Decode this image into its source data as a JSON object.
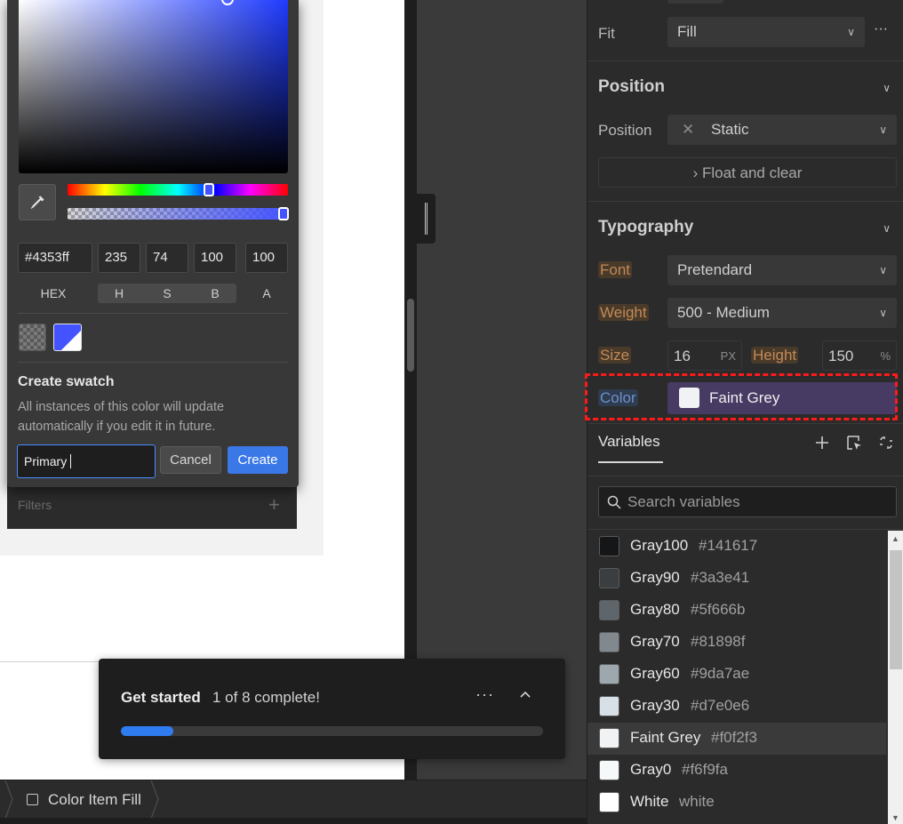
{
  "color_picker": {
    "hex": "#4353ff",
    "h": "235",
    "s": "74",
    "b": "100",
    "a": "100",
    "labels": {
      "hex": "HEX",
      "h": "H",
      "s": "S",
      "b": "B",
      "a": "A"
    },
    "swatch_title": "Create swatch",
    "swatch_description": "All instances of this color will update automatically if you edit it in future.",
    "swatch_name_value": "Primary",
    "cancel_label": "Cancel",
    "create_label": "Create",
    "selected_color": "#4353ff",
    "icon": "eyedropper-icon"
  },
  "canvas": {
    "filters_label": "Filters",
    "filters_add_glyph": "+"
  },
  "right_panel": {
    "fit": {
      "label": "Fit",
      "value": "Fill",
      "more": "···"
    },
    "position_section": {
      "title": "Position",
      "position_label": "Position",
      "position_value": "Static",
      "float_label": "Float and clear",
      "clear_glyph": "✕",
      "float_glyph": "›"
    },
    "typography_section": {
      "title": "Typography",
      "font_label": "Font",
      "font_value": "Pretendard",
      "weight_label": "Weight",
      "weight_value": "500 - Medium",
      "size_label": "Size",
      "size_value": "16",
      "size_unit": "PX",
      "height_label": "Height",
      "height_value": "150",
      "height_unit": "%",
      "color_label": "Color",
      "color_value": "Faint Grey",
      "color_swatch": "#f0f2f3"
    }
  },
  "variables": {
    "tab_label": "Variables",
    "search_placeholder": "Search variables",
    "tools": [
      "plus-icon",
      "select-element-icon",
      "detach-icon"
    ],
    "items": [
      {
        "name": "Gray100",
        "value": "#141617",
        "color": "#141617"
      },
      {
        "name": "Gray90",
        "value": "#3a3e41",
        "color": "#3a3e41"
      },
      {
        "name": "Gray80",
        "value": "#5f666b",
        "color": "#5f666b"
      },
      {
        "name": "Gray70",
        "value": "#81898f",
        "color": "#81898f"
      },
      {
        "name": "Gray60",
        "value": "#9da7ae",
        "color": "#9da7ae"
      },
      {
        "name": "Gray30",
        "value": "#d7e0e6",
        "color": "#d7e0e6"
      },
      {
        "name": "Faint Grey",
        "value": "#f0f2f3",
        "color": "#f0f2f3"
      },
      {
        "name": "Gray0",
        "value": "#f6f9fa",
        "color": "#f6f9fa"
      },
      {
        "name": "White",
        "value": "white",
        "color": "#ffffff"
      }
    ],
    "selected_index": 6
  },
  "get_started": {
    "title": "Get started",
    "progress_text": "1 of 8 complete!",
    "progress_fraction": 0.125,
    "more_glyph": "···"
  },
  "breadcrumb": {
    "label": "Color Item Fill"
  }
}
